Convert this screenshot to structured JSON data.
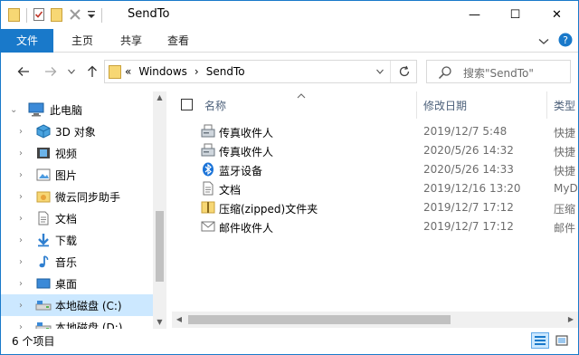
{
  "window": {
    "title": "SendTo",
    "controls": {
      "minimize": "—",
      "maximize": "☐",
      "close": "✕"
    }
  },
  "ribbon": {
    "tabs": {
      "file": "文件",
      "home": "主页",
      "share": "共享",
      "view": "查看"
    },
    "help_label": "?"
  },
  "address": {
    "overflow": "«",
    "crumbs": [
      "Windows",
      "SendTo"
    ],
    "separator": "›"
  },
  "search": {
    "placeholder": "搜索\"SendTo\""
  },
  "nav": {
    "items": [
      {
        "label": "此电脑",
        "icon": "computer-icon",
        "chevron": "⌄"
      },
      {
        "label": "3D 对象",
        "icon": "3d-objects-icon",
        "chevron": "›"
      },
      {
        "label": "视频",
        "icon": "video-icon",
        "chevron": "›"
      },
      {
        "label": "图片",
        "icon": "pictures-icon",
        "chevron": "›"
      },
      {
        "label": "微云同步助手",
        "icon": "weiyun-icon",
        "chevron": "›"
      },
      {
        "label": "文档",
        "icon": "documents-icon",
        "chevron": "›"
      },
      {
        "label": "下载",
        "icon": "download-icon",
        "chevron": "›"
      },
      {
        "label": "音乐",
        "icon": "music-icon",
        "chevron": "›"
      },
      {
        "label": "桌面",
        "icon": "desktop-icon",
        "chevron": "›"
      },
      {
        "label": "本地磁盘 (C:)",
        "icon": "drive-icon",
        "chevron": "›"
      },
      {
        "label": "本地磁盘 (D:)",
        "icon": "drive-icon",
        "chevron": "›"
      }
    ],
    "selected_index": 9
  },
  "columns": {
    "name": "名称",
    "date": "修改日期",
    "type": "类型"
  },
  "files": [
    {
      "name": "传真收件人",
      "date": "2019/12/7 5:48",
      "type": "快捷",
      "icon": "fax-icon"
    },
    {
      "name": "传真收件人",
      "date": "2020/5/26 14:32",
      "type": "快捷",
      "icon": "fax-icon"
    },
    {
      "name": "蓝牙设备",
      "date": "2020/5/26 14:33",
      "type": "快捷",
      "icon": "bluetooth-icon"
    },
    {
      "name": "文档",
      "date": "2019/12/16 13:20",
      "type": "MyD",
      "icon": "documents-icon"
    },
    {
      "name": "压缩(zipped)文件夹",
      "date": "2019/12/7 17:12",
      "type": "压缩",
      "icon": "zip-folder-icon"
    },
    {
      "name": "邮件收件人",
      "date": "2019/12/7 17:12",
      "type": "邮件",
      "icon": "mail-icon"
    }
  ],
  "status": {
    "item_count": "6 个项目"
  },
  "colors": {
    "accent": "#1979ca",
    "selection": "#cce8ff",
    "folder": "#f7d774"
  }
}
